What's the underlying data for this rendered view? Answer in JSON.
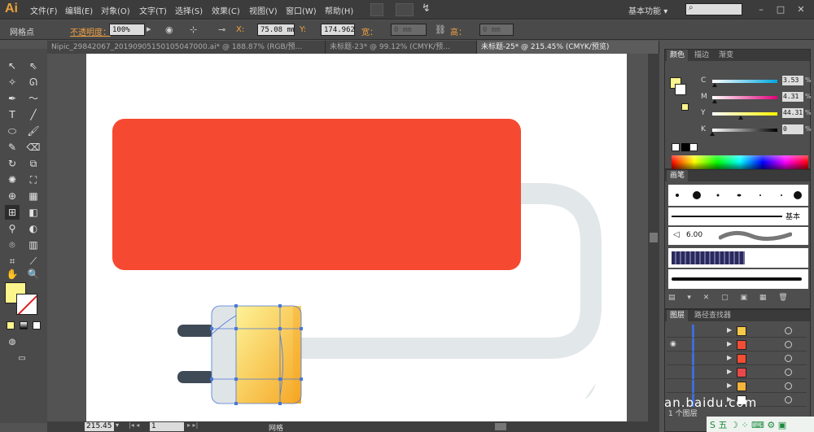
{
  "app": {
    "logo": "Ai"
  },
  "menu": [
    {
      "label": "文件(F)"
    },
    {
      "label": "编辑(E)"
    },
    {
      "label": "对象(O)"
    },
    {
      "label": "文字(T)"
    },
    {
      "label": "选择(S)"
    },
    {
      "label": "效果(C)"
    },
    {
      "label": "视图(V)"
    },
    {
      "label": "窗口(W)"
    },
    {
      "label": "帮助(H)"
    }
  ],
  "workspace": {
    "label": "基本功能",
    "caret": "▾"
  },
  "window_controls": {
    "minimize": "–",
    "maximize": "□",
    "close": "✕"
  },
  "control_bar": {
    "tool_label": "网格点",
    "opacity_label": "不透明度：",
    "opacity_value": "100%",
    "x_label": "X:",
    "x_value": "75.08 mm",
    "y_label": "Y:",
    "y_value": "174.962",
    "w_label": "宽：",
    "w_value": "0 mm",
    "h_label": "高：",
    "h_value": "0 mm"
  },
  "tabs": [
    {
      "label": "Nipic_29842067_20190905150105047000.ai* @ 188.87% (RGB/预..."
    },
    {
      "label": "未标题-23* @ 99.12% (CMYK/预..."
    },
    {
      "label": "未标题-25* @ 215.45% (CMYK/预览)"
    }
  ],
  "status_bar": {
    "zoom": "215.45",
    "page": "1",
    "label": "网格"
  },
  "color_panel": {
    "tabs": [
      "颜色",
      "描边",
      "渐变"
    ],
    "channels": [
      {
        "letter": "C",
        "value": "3.53",
        "pct": "%",
        "pos": 3.53,
        "from": "#ffffff",
        "to": "#00a8e0"
      },
      {
        "letter": "M",
        "value": "4.31",
        "pct": "%",
        "pos": 4.31,
        "from": "#ffffff",
        "to": "#e0007a"
      },
      {
        "letter": "Y",
        "value": "44.31",
        "pct": "%",
        "pos": 44.31,
        "from": "#ffffff",
        "to": "#fff200"
      },
      {
        "letter": "K",
        "value": "0",
        "pct": "%",
        "pos": 0,
        "from": "#ffffff",
        "to": "#000000"
      }
    ],
    "fill_color": "#fcf48c"
  },
  "brush_panel": {
    "tab": "画笔",
    "basic_label": "基本",
    "size_value": "6.00"
  },
  "layers_panel": {
    "tabs": [
      "图层",
      "路径查找器"
    ],
    "count_label": "1 个图层",
    "rows": [
      {
        "thumb_color": "#f7c948"
      },
      {
        "thumb_color": "#f24d35"
      },
      {
        "thumb_color": "#f24d35"
      },
      {
        "thumb_color": "#e8484a"
      },
      {
        "thumb_color": "#f5b43c"
      },
      {
        "thumb_color": "#ffffff"
      }
    ]
  },
  "artwork": {
    "block_color": "#f54a31",
    "cord_color": "#e2e7ea",
    "plug_body_color": "#dfe4e7",
    "plug_gradient": [
      "#fdf398",
      "#f5a623"
    ],
    "prong_color": "#3f4a57"
  },
  "watermark": {
    "text": "an.baidu.com"
  },
  "taskbar": {
    "ime": "五",
    "items": "S 五 ☽ ⁘ ⌨ ⚙ ▣"
  }
}
